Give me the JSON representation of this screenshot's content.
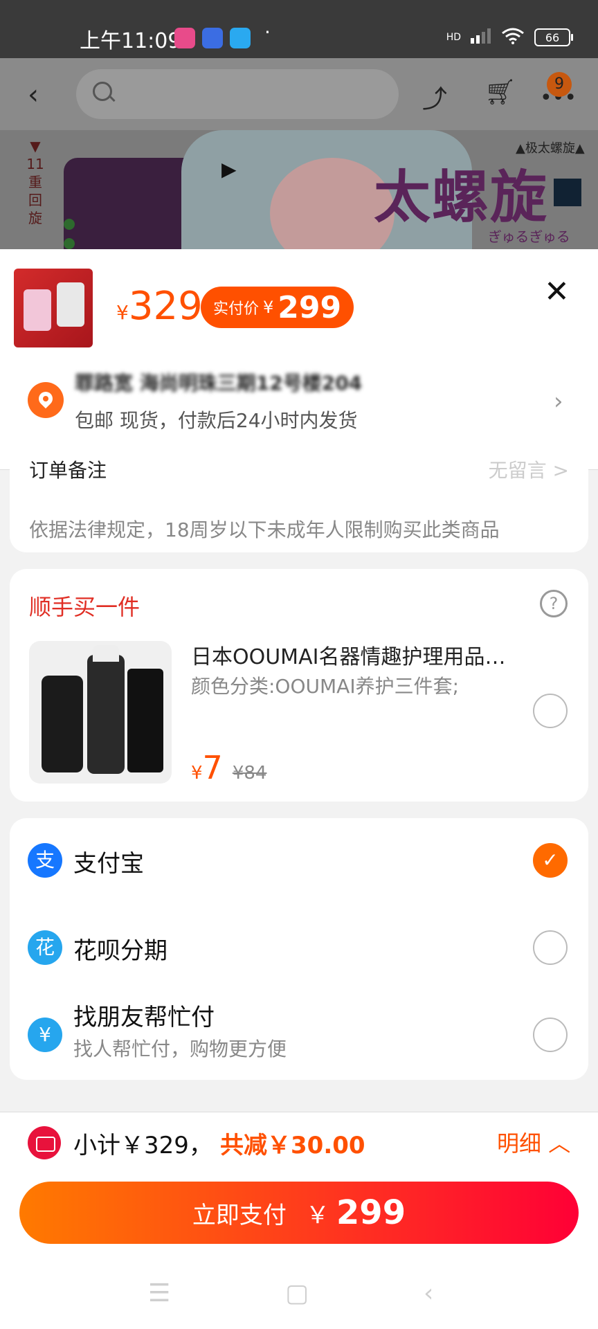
{
  "status_bar": {
    "time": "上午11:09",
    "battery": "66",
    "signal_label": "HD",
    "app_icon_colors": [
      "#e84b8a",
      "#3b6de3",
      "#2aa9f0"
    ]
  },
  "top_nav": {
    "cart_badge": "9",
    "icons": [
      "back-arrow-icon",
      "search-icon",
      "share-icon",
      "cart-icon",
      "more-icon"
    ]
  },
  "banner": {
    "title": "太螺旋",
    "subtitle": "ぎゅるぎゅる",
    "tag": "▲极太螺旋▲",
    "vertical_text": "▼ 11 重回旋"
  },
  "product_sheet": {
    "price_currency": "¥",
    "price": "329",
    "pay_label": "实付价",
    "pay_currency": "¥",
    "pay_price": "299",
    "address": "罪路宽 海尚明珠三期12号楼204",
    "shipping": "包邮  现货，付款后24小时内发货"
  },
  "notes_card": {
    "label": "订单备注",
    "value": "无留言 >",
    "legal": "依据法律规定，18周岁以下未成年人限制购买此类商品"
  },
  "addon_card": {
    "title": "顺手买一件",
    "product_name": "日本OOUMAI名器情趣护理用品…",
    "product_spec": "颜色分类:OOUMAI养护三件套;",
    "price_currency": "¥",
    "price": "7",
    "original_price": "¥84",
    "selected": false
  },
  "payment": {
    "options": [
      {
        "name": "支付宝",
        "sub": "",
        "icon": "alipay-icon",
        "color": "#1677ff",
        "selected": true
      },
      {
        "name": "花呗分期",
        "sub": "",
        "icon": "huabei-icon",
        "color": "#26a6ee",
        "selected": false
      },
      {
        "name": "找朋友帮忙付",
        "sub": "找人帮忙付，购物更方便",
        "icon": "friend-pay-icon",
        "color": "#26a6ee",
        "selected": false
      }
    ]
  },
  "footer": {
    "subtotal": "小计￥329，",
    "saving": "共减￥30.00",
    "detail_label": "明细",
    "pay_button_label": "立即支付",
    "pay_button_currency": "￥",
    "pay_button_amount": "299"
  },
  "colors": {
    "accent": "#ff5000",
    "red": "#e02e24",
    "pay_gradient": [
      "#ff7a00",
      "#ff0036"
    ]
  }
}
